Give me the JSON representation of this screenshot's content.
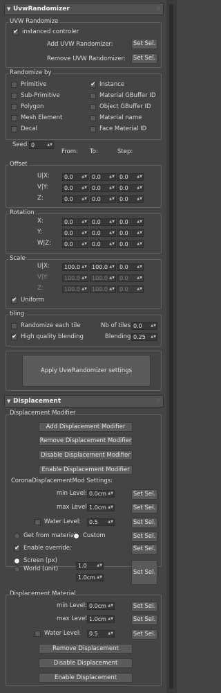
{
  "uvw": {
    "title": "UvwRandomizer",
    "randomize_group": "UVW Randomize",
    "instanced_controler": "instanced controler",
    "add_label": "Add UVW Randomizer:",
    "remove_label": "Remove UVW Randomizer:",
    "set_sel": "Set Sel.",
    "randomize_by": "Randomize by",
    "options_left": [
      "Primitive",
      "Sub-Primitive",
      "Polygon",
      "Mesh Element",
      "Decal"
    ],
    "options_right": [
      "Instance",
      "Material GBuffer ID",
      "Object GBuffer ID",
      "Material name",
      "Face Material ID"
    ],
    "seed_label": "Seed",
    "seed_value": "0",
    "col_from": "From:",
    "col_to": "To:",
    "col_step": "Step:",
    "offset": {
      "title": "Offset",
      "rows": [
        {
          "label": "U|X:",
          "v": [
            "0.0",
            "0.0",
            "0.0"
          ]
        },
        {
          "label": "V|Y:",
          "v": [
            "0.0",
            "0.0",
            "0.0"
          ]
        },
        {
          "label": "Z:",
          "v": [
            "0.0",
            "0.0",
            "0.0"
          ]
        }
      ]
    },
    "rotation": {
      "title": "Rotation",
      "rows": [
        {
          "label": "X:",
          "v": [
            "0.0",
            "0.0",
            "0.0"
          ]
        },
        {
          "label": "Y:",
          "v": [
            "0.0",
            "0.0",
            "0.0"
          ]
        },
        {
          "label": "W|Z:",
          "v": [
            "0.0",
            "0.0",
            "0.0"
          ]
        }
      ]
    },
    "scale": {
      "title": "Scale",
      "rows": [
        {
          "label": "U|X:",
          "v": [
            "100.0",
            "100.0",
            "0.0"
          ]
        },
        {
          "label": "V|Y:",
          "v": [
            "100.0",
            "100.0",
            "0.0"
          ]
        },
        {
          "label": "Z:",
          "v": [
            "100.0",
            "100.0",
            "0.0"
          ]
        }
      ]
    },
    "uniform": "Uniform",
    "tiling_title": "tiling",
    "randomize_each_tile": "Randomize each tile",
    "nb_tiles_label": "Nb of tiles:",
    "nb_tiles_value": "0.0",
    "high_quality_blending": "High quality blending",
    "blending_label": "Blending:",
    "blending_value": "0.25",
    "apply_button": "Apply UvwRandomizer settings"
  },
  "disp": {
    "title": "Displacement",
    "modifier_group": "Displacement Modifier",
    "add_modifier": "Add Displacement Modifier",
    "remove_modifier": "Remove Displacement Modifier",
    "disable_modifier": "Disable Displacement Modifier",
    "enable_modifier": "Enable Displacement Modifier",
    "corona_settings": "CoronaDisplacementMod Settings:",
    "min_level_label": "min Level:",
    "min_level_value": "0.0cm",
    "max_level_label": "max Level:",
    "max_level_value": "1.0cm",
    "water_level_label": "Water Level:",
    "water_level_value": "0.5",
    "get_from_material": "Get from material",
    "custom": "Custom",
    "enable_override": "Enable override:",
    "screen_px": "Screen (px)",
    "world_unit": "World (unit)",
    "screen_value": "1.0",
    "world_value": "1.0cm",
    "set_sel": "Set Sel.",
    "material_group": "Displacement Material",
    "mat_min_label": "min Level:",
    "mat_min_value": "0.0cm",
    "mat_max_label": "max Level:",
    "mat_max_value": "1.0cm",
    "mat_water_label": "Water Level:",
    "mat_water_value": "0.5",
    "remove_displacement": "Remove Displacement",
    "disable_displacement": "Disable Displacement",
    "enable_displacement": "Enable Displacement"
  },
  "icons": {
    "collapse": "triangle-down-icon",
    "pin": "pin-icon",
    "check": "checkmark-icon",
    "spinner": "spinner-arrows-icon"
  }
}
